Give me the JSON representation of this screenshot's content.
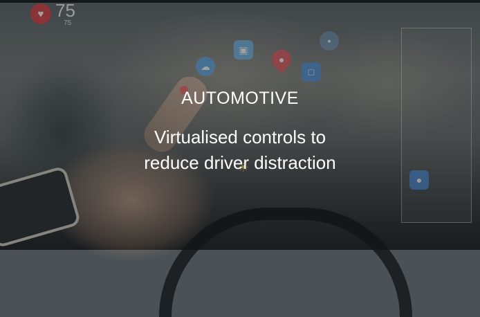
{
  "hero": {
    "category": "AUTOMOTIVE",
    "tagline_line1": "Virtualised controls to",
    "tagline_line2": "reduce driver distraction"
  },
  "hud": {
    "bpm_value": "75",
    "bpm_sub": "75"
  },
  "icons": [
    "heart-icon",
    "cloud-icon",
    "image-icon",
    "map-pin-icon",
    "screen-icon",
    "chat-bubble-icon",
    "sun-icon",
    "notification-icon"
  ],
  "colors": {
    "text": "#ffffff",
    "heart": "#d9424a",
    "cloud": "#5aa5e6",
    "pin": "#e25760",
    "hud_label": "#e33b3b"
  }
}
